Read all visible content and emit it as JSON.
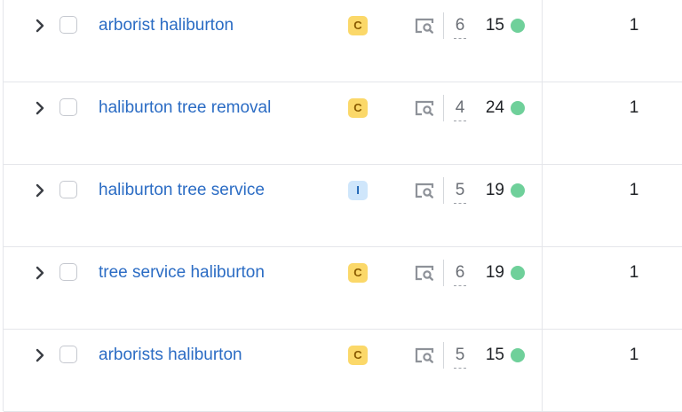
{
  "rows": [
    {
      "keyword": "arborist haliburton",
      "intent": "C",
      "intent_type": "commercial",
      "serp_features": "6",
      "difficulty": "15",
      "difficulty_color": "#6fd09a",
      "results": "1"
    },
    {
      "keyword": "haliburton tree removal",
      "intent": "C",
      "intent_type": "commercial",
      "serp_features": "4",
      "difficulty": "24",
      "difficulty_color": "#6fd09a",
      "results": "1"
    },
    {
      "keyword": "haliburton tree service",
      "intent": "I",
      "intent_type": "informational",
      "serp_features": "5",
      "difficulty": "19",
      "difficulty_color": "#6fd09a",
      "results": "1"
    },
    {
      "keyword": "tree service haliburton",
      "intent": "C",
      "intent_type": "commercial",
      "serp_features": "6",
      "difficulty": "19",
      "difficulty_color": "#6fd09a",
      "results": "1"
    },
    {
      "keyword": "arborists haliburton",
      "intent": "C",
      "intent_type": "commercial",
      "serp_features": "5",
      "difficulty": "15",
      "difficulty_color": "#6fd09a",
      "results": "1"
    }
  ],
  "icons": {
    "expand": "chevron-right-icon",
    "serp": "serp-preview-icon"
  },
  "colors": {
    "keyword_link": "#2b6cc4",
    "commercial": "#fbd869",
    "informational": "#cfe6fb"
  }
}
